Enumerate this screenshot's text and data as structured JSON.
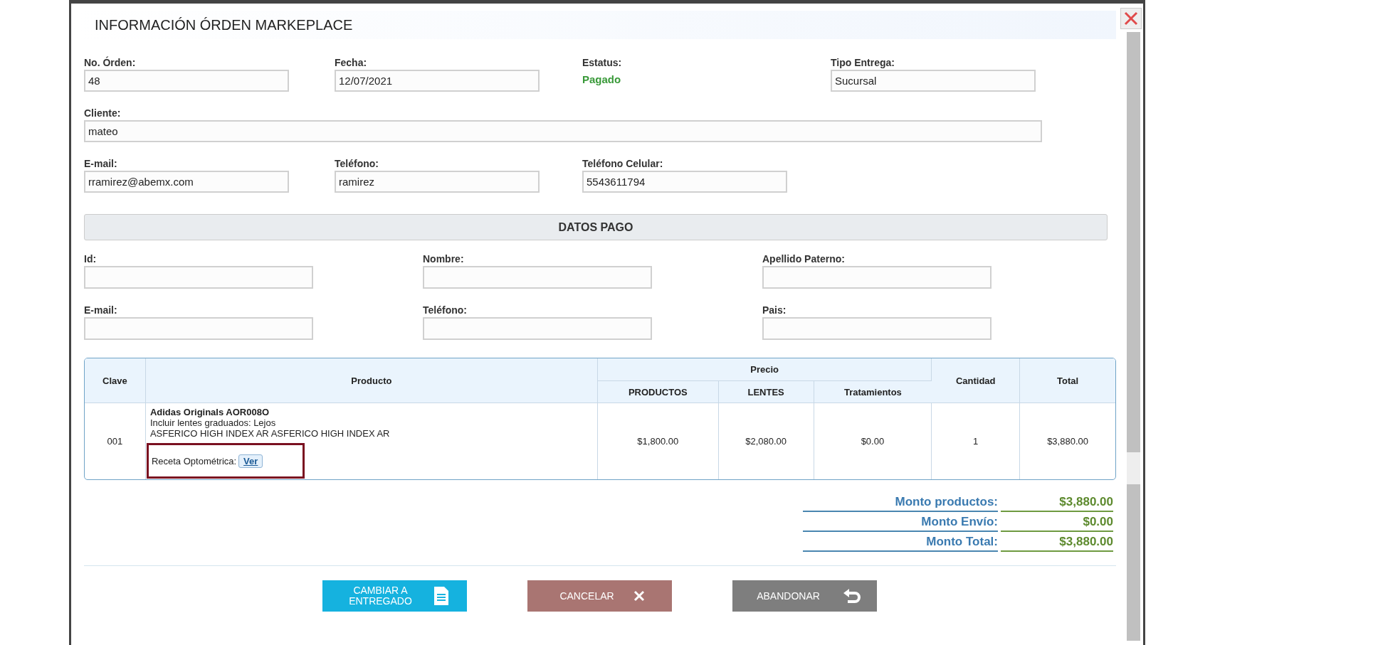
{
  "dialog": {
    "title": "INFORMACIÓN ÓRDEN MARKEPLACE"
  },
  "order_rows": [
    [
      {
        "kind": "field",
        "label": "No. Órden:",
        "value": "48"
      },
      {
        "kind": "field",
        "label": "Fecha:",
        "value": "12/07/2021"
      },
      {
        "kind": "status",
        "label": "Estatus:",
        "value": "Pagado"
      },
      {
        "kind": "field",
        "label": "Tipo Entrega:",
        "value": "Sucursal"
      }
    ],
    [
      {
        "kind": "wide",
        "label": "Cliente:",
        "value": "mateo"
      }
    ],
    [
      {
        "kind": "field",
        "label": "E-mail:",
        "value": "rramirez@abemx.com"
      },
      {
        "kind": "field",
        "label": "Teléfono:",
        "value": "ramirez"
      },
      {
        "kind": "field",
        "label": "Teléfono Celular:",
        "value": "5543611794"
      }
    ]
  ],
  "payment": {
    "title": "DATOS PAGO",
    "fields": [
      {
        "label": "Id:"
      },
      {
        "label": "Nombre:"
      },
      {
        "label": "Apellido Paterno:"
      },
      {
        "label": "E-mail:"
      },
      {
        "label": "Teléfono:"
      },
      {
        "label": "Pais:"
      }
    ]
  },
  "table": {
    "columns": [
      {
        "label": "Clave"
      },
      {
        "label": "Producto"
      },
      {
        "label": "Precio",
        "children": [
          {
            "label": "PRODUCTOS"
          },
          {
            "label": "LENTES"
          },
          {
            "label": "Tratamientos"
          }
        ]
      },
      {
        "label": "Cantidad"
      },
      {
        "label": "Total"
      }
    ],
    "rows": [
      {
        "clave": "001",
        "product": {
          "name": "Adidas Originals AOR008O",
          "lines": [
            "Incluir lentes graduados: Lejos",
            "ASFERICO HIGH INDEX AR ASFERICO HIGH INDEX AR"
          ],
          "prescription_label": "Receta Optométrica:",
          "prescription_link": "Ver",
          "highlighted": true
        },
        "productos": "$1,800.00",
        "lentes": "$2,080.00",
        "tratamientos": "$0.00",
        "cantidad": "1",
        "total": "$3,880.00"
      }
    ]
  },
  "totals": [
    {
      "label": "Monto productos:",
      "value": "$3,880.00"
    },
    {
      "label": "Monto Envío:",
      "value": "$0.00"
    },
    {
      "label": "Monto Total:",
      "value": "$3,880.00"
    }
  ],
  "buttons": [
    {
      "kind": "deliver",
      "label": "CAMBIAR A ENTREGADO"
    },
    {
      "kind": "cancel",
      "label": "CANCELAR"
    },
    {
      "kind": "back",
      "label": "ABANDONAR"
    }
  ]
}
